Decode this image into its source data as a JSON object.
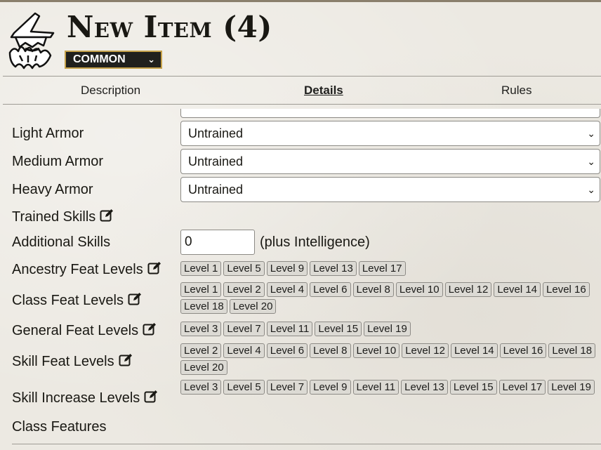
{
  "header": {
    "title": "New Item (4)",
    "rarity": "COMMON"
  },
  "tabs": [
    {
      "label": "Description"
    },
    {
      "label": "Details",
      "active": true
    },
    {
      "label": "Rules"
    }
  ],
  "proficiencies": {
    "light_armor": {
      "label": "Light Armor",
      "value": "Untrained"
    },
    "medium_armor": {
      "label": "Medium Armor",
      "value": "Untrained"
    },
    "heavy_armor": {
      "label": "Heavy Armor",
      "value": "Untrained"
    }
  },
  "trained_skills": {
    "label": "Trained Skills"
  },
  "additional_skills": {
    "label": "Additional Skills",
    "value": "0",
    "suffix": "(plus Intelligence)"
  },
  "ancestry_feat_levels": {
    "label": "Ancestry Feat Levels",
    "tags": [
      "Level 1",
      "Level 5",
      "Level 9",
      "Level 13",
      "Level 17"
    ]
  },
  "class_feat_levels": {
    "label": "Class Feat Levels",
    "tags": [
      "Level 1",
      "Level 2",
      "Level 4",
      "Level 6",
      "Level 8",
      "Level 10",
      "Level 12",
      "Level 14",
      "Level 16",
      "Level 18",
      "Level 20"
    ]
  },
  "general_feat_levels": {
    "label": "General Feat Levels",
    "tags": [
      "Level 3",
      "Level 7",
      "Level 11",
      "Level 15",
      "Level 19"
    ]
  },
  "skill_feat_levels": {
    "label": "Skill Feat Levels",
    "tags": [
      "Level 2",
      "Level 4",
      "Level 6",
      "Level 8",
      "Level 10",
      "Level 12",
      "Level 14",
      "Level 16",
      "Level 18",
      "Level 20"
    ]
  },
  "skill_increase_levels": {
    "label": "Skill Increase Levels",
    "tags": [
      "Level 3",
      "Level 5",
      "Level 7",
      "Level 9",
      "Level 11",
      "Level 13",
      "Level 15",
      "Level 17",
      "Level 19"
    ]
  },
  "class_features": {
    "label": "Class Features"
  },
  "icons": {
    "logo": "wizard-icon",
    "edit": "edit-icon",
    "dropdown": "chevron-down-icon"
  }
}
